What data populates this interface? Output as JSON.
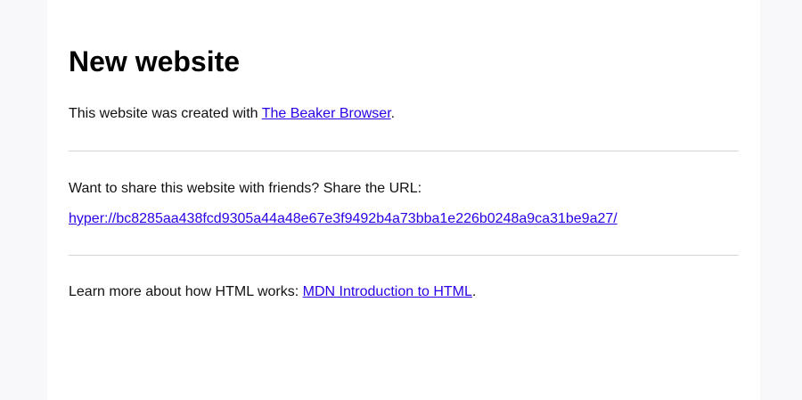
{
  "heading": "New website",
  "intro": {
    "prefix": "This website was created with ",
    "link_text": "The Beaker Browser",
    "suffix": "."
  },
  "share": {
    "prompt": "Want to share this website with friends? Share the URL:",
    "url": "hyper://bc8285aa438fcd9305a44a48e67e3f9492b4a73bba1e226b0248a9ca31be9a27/"
  },
  "learn": {
    "prefix": "Learn more about how HTML works: ",
    "link_text": "MDN Introduction to HTML",
    "suffix": "."
  },
  "colors": {
    "link": "#2a00e6",
    "background": "#f8f8fb",
    "content": "#ffffff"
  }
}
